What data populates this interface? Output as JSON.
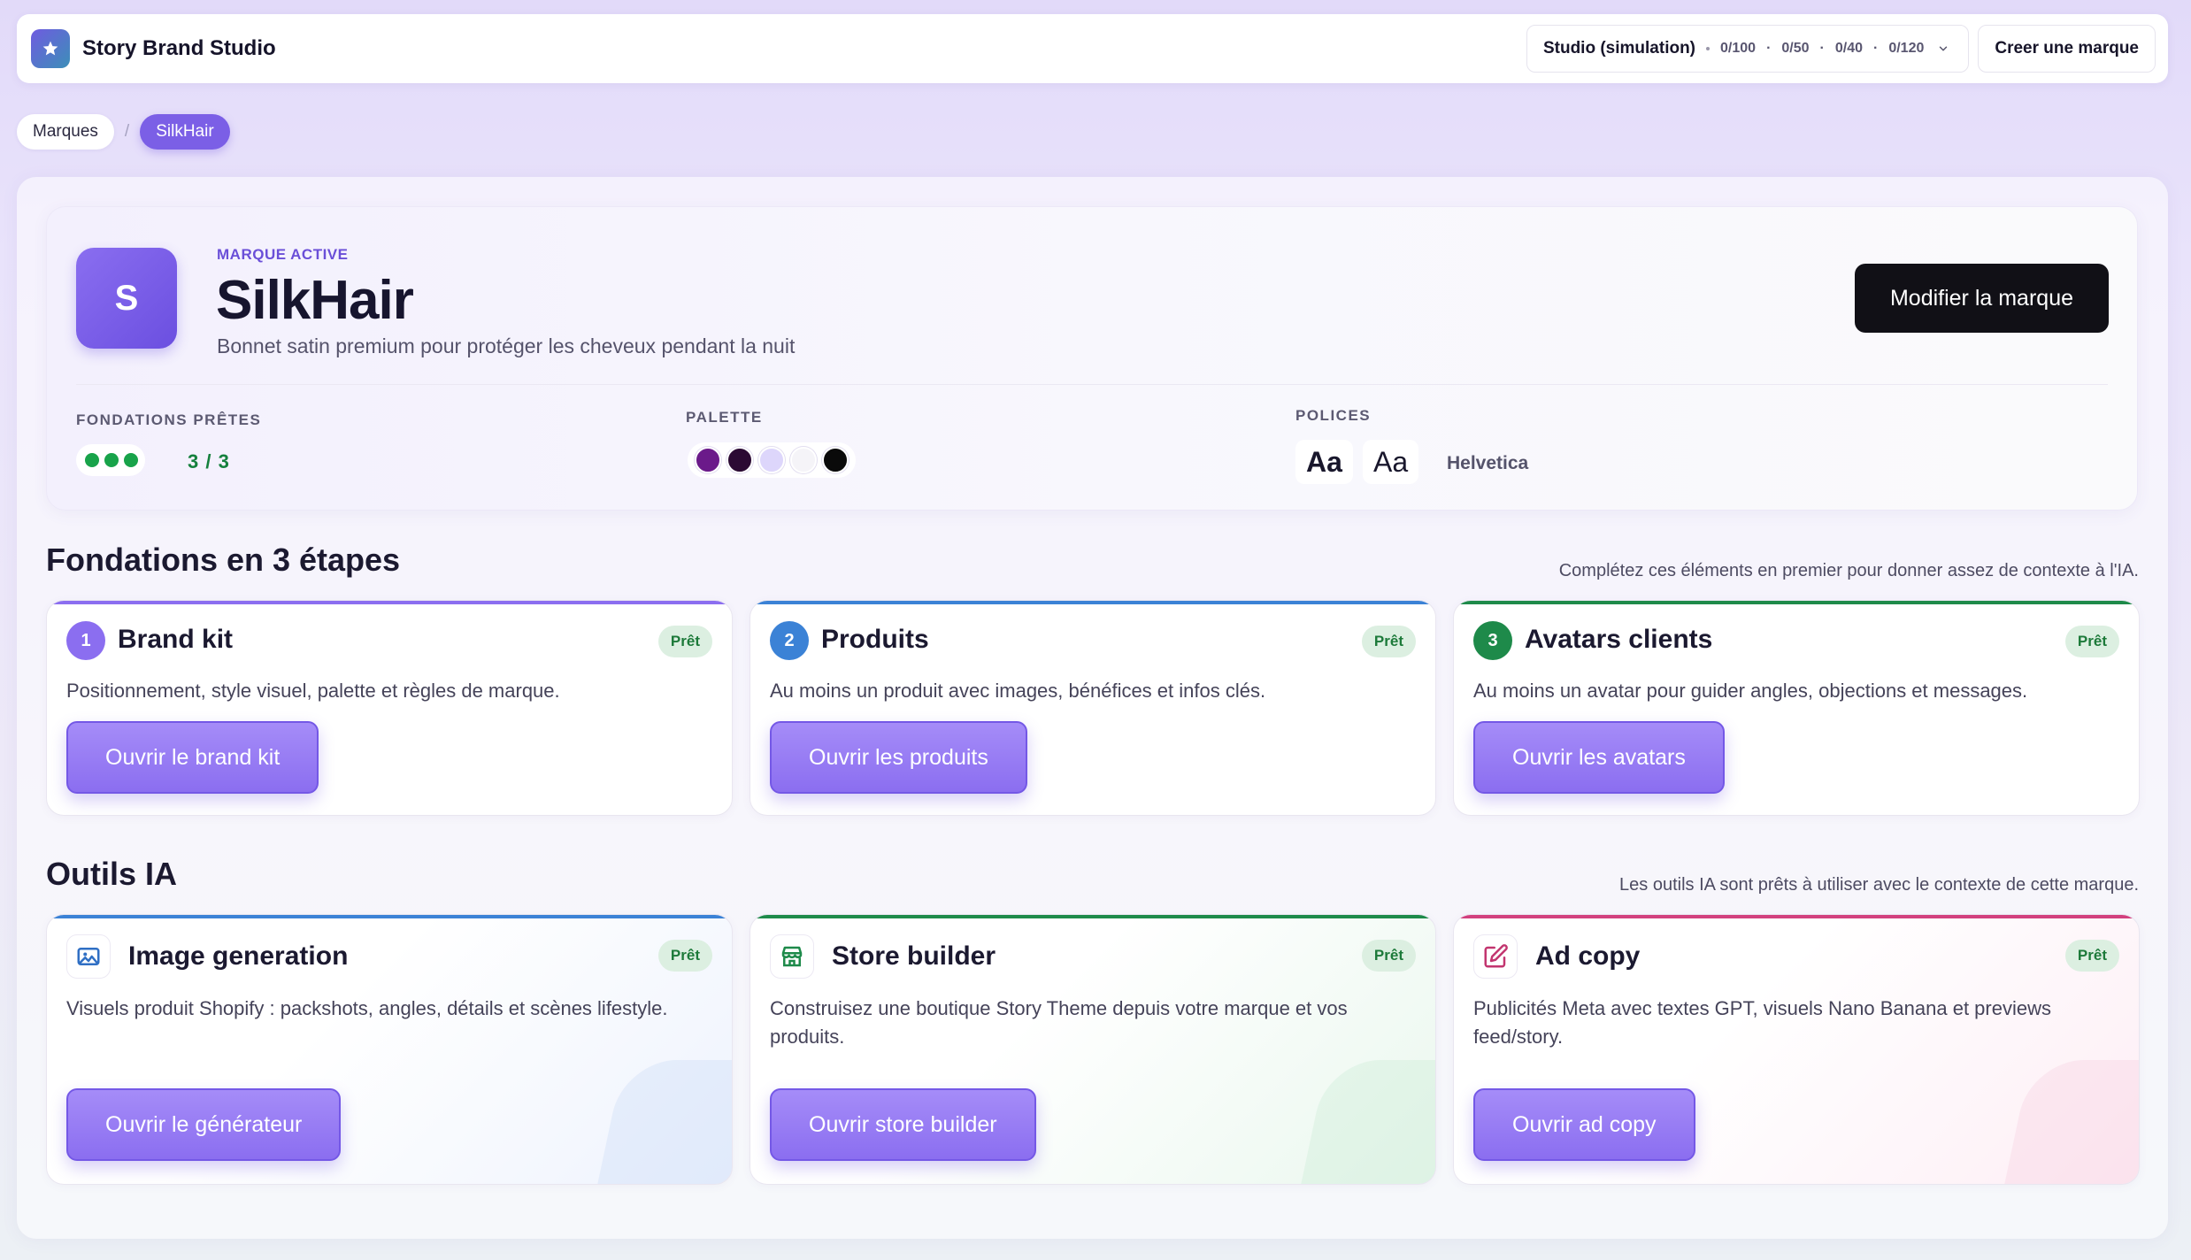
{
  "header": {
    "app_title": "Story Brand Studio",
    "logo_icon": "star-icon",
    "plan_name": "Studio (simulation)",
    "plan_usage": [
      "0/100",
      "0/50",
      "0/40",
      "0/120"
    ],
    "plan_separator": "·",
    "create_label": "Creer une marque"
  },
  "breadcrumb": {
    "items": [
      "Marques",
      "SilkHair"
    ],
    "separator": "/"
  },
  "brand": {
    "avatar_letter": "S",
    "kicker": "MARQUE ACTIVE",
    "name": "SilkHair",
    "tagline": "Bonnet satin premium pour protéger les cheveux pendant la nuit",
    "edit_label": "Modifier la marque",
    "foundations_label": "FONDATIONS PRÊTES",
    "foundations_count": "3 / 3",
    "foundations_done": 3,
    "palette_label": "PALETTE",
    "palette": [
      "#6b1a8a",
      "#2b0a33",
      "#ddd6fb",
      "#f5f4f8",
      "#0a0a0a"
    ],
    "fonts_label": "POLICES",
    "font_samples": [
      "Aa",
      "Aa"
    ],
    "font_name": "Helvetica"
  },
  "foundations": {
    "title": "Fondations en 3 étapes",
    "subtitle": "Complétez ces éléments en premier pour donner assez de contexte à l'IA.",
    "cards": [
      {
        "num": "1",
        "title": "Brand kit",
        "badge": "Prêt",
        "desc": "Positionnement, style visuel, palette et règles de marque.",
        "button": "Ouvrir le brand kit",
        "color": "#8b6ef0"
      },
      {
        "num": "2",
        "title": "Produits",
        "badge": "Prêt",
        "desc": "Au moins un produit avec images, bénéfices et infos clés.",
        "button": "Ouvrir les produits",
        "color": "#3b82d6"
      },
      {
        "num": "3",
        "title": "Avatars clients",
        "badge": "Prêt",
        "desc": "Au moins un avatar pour guider angles, objections et messages.",
        "button": "Ouvrir les avatars",
        "color": "#1e8a4a"
      }
    ]
  },
  "tools": {
    "title": "Outils IA",
    "subtitle": "Les outils IA sont prêts à utiliser avec le contexte de cette marque.",
    "cards": [
      {
        "icon": "image-icon",
        "title": "Image generation",
        "badge": "Prêt",
        "desc": "Visuels produit Shopify : packshots, angles, détails et scènes lifestyle.",
        "button": "Ouvrir le générateur",
        "color": "#3b82d6"
      },
      {
        "icon": "store-icon",
        "title": "Store builder",
        "badge": "Prêt",
        "desc": "Construisez une boutique Story Theme depuis votre marque et vos produits.",
        "button": "Ouvrir store builder",
        "color": "#1e8a4a"
      },
      {
        "icon": "edit-icon",
        "title": "Ad copy",
        "badge": "Prêt",
        "desc": "Publicités Meta avec textes GPT, visuels Nano Banana et previews feed/story.",
        "button": "Ouvrir ad copy",
        "color": "#d2407e"
      }
    ]
  }
}
